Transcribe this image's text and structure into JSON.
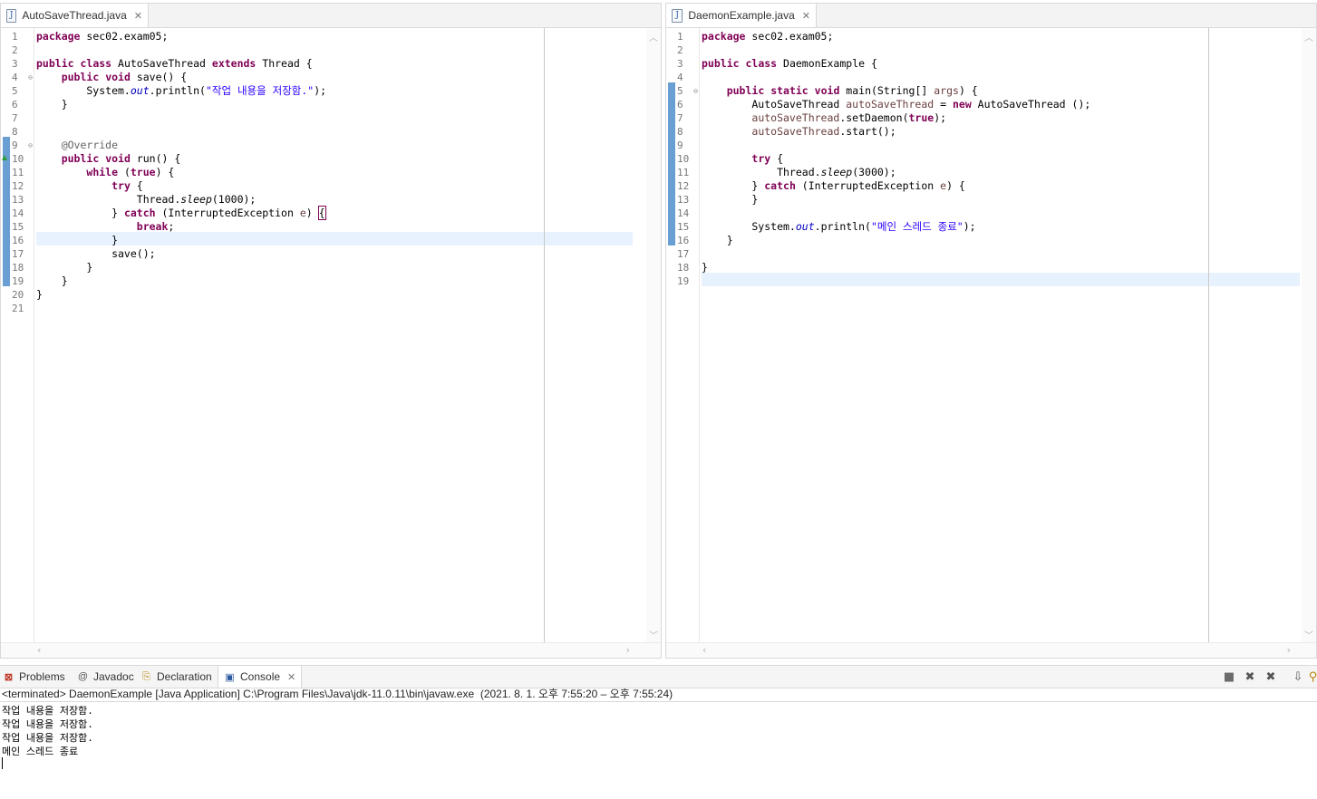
{
  "left_editor": {
    "tab_title": "AutoSaveThread.java",
    "tab_icon": "java-file-icon",
    "line_numbers": [
      "1",
      "2",
      "3",
      "4",
      "5",
      "6",
      "7",
      "8",
      "9",
      "10",
      "11",
      "12",
      "13",
      "14",
      "15",
      "16",
      "17",
      "18",
      "19",
      "20",
      "21"
    ],
    "code_lines": [
      [
        {
          "t": "package",
          "c": "kw"
        },
        {
          "t": " sec02.exam05;"
        }
      ],
      [],
      [
        {
          "t": "public",
          "c": "kw"
        },
        {
          "t": " "
        },
        {
          "t": "class",
          "c": "kw"
        },
        {
          "t": " AutoSaveThread "
        },
        {
          "t": "extends",
          "c": "kw"
        },
        {
          "t": " Thread {"
        }
      ],
      [
        {
          "t": "    "
        },
        {
          "t": "public",
          "c": "kw"
        },
        {
          "t": " "
        },
        {
          "t": "void",
          "c": "kw"
        },
        {
          "t": " save() {"
        }
      ],
      [
        {
          "t": "        System."
        },
        {
          "t": "out",
          "c": "fld"
        },
        {
          "t": ".println("
        },
        {
          "t": "\"작업 내용을 저장함.\"",
          "c": "str"
        },
        {
          "t": ");"
        }
      ],
      [
        {
          "t": "    }"
        }
      ],
      [],
      [],
      [
        {
          "t": "    "
        },
        {
          "t": "@Override",
          "c": "ann"
        }
      ],
      [
        {
          "t": "    "
        },
        {
          "t": "public",
          "c": "kw"
        },
        {
          "t": " "
        },
        {
          "t": "void",
          "c": "kw"
        },
        {
          "t": " run() {"
        }
      ],
      [
        {
          "t": "        "
        },
        {
          "t": "while",
          "c": "kw"
        },
        {
          "t": " ("
        },
        {
          "t": "true",
          "c": "kw"
        },
        {
          "t": ") {"
        }
      ],
      [
        {
          "t": "            "
        },
        {
          "t": "try",
          "c": "kw"
        },
        {
          "t": " {"
        }
      ],
      [
        {
          "t": "                Thread."
        },
        {
          "t": "sleep",
          "c": "ital"
        },
        {
          "t": "(1000);"
        }
      ],
      [
        {
          "t": "            } "
        },
        {
          "t": "catch",
          "c": "kw"
        },
        {
          "t": " (InterruptedException "
        },
        {
          "t": "e",
          "c": "var"
        },
        {
          "t": ") "
        },
        {
          "t": "{",
          "c": "bracket"
        }
      ],
      [
        {
          "t": "                "
        },
        {
          "t": "break",
          "c": "kw"
        },
        {
          "t": ";"
        }
      ],
      [
        {
          "t": "            }"
        }
      ],
      [
        {
          "t": "            save();"
        }
      ],
      [
        {
          "t": "        }"
        }
      ],
      [
        {
          "t": "    }"
        }
      ],
      [
        {
          "t": "}"
        }
      ],
      []
    ]
  },
  "right_editor": {
    "tab_title": "DaemonExample.java",
    "tab_icon": "java-file-icon",
    "line_numbers": [
      "1",
      "2",
      "3",
      "4",
      "5",
      "6",
      "7",
      "8",
      "9",
      "10",
      "11",
      "12",
      "13",
      "14",
      "15",
      "16",
      "17",
      "18",
      "19"
    ],
    "code_lines": [
      [
        {
          "t": "package",
          "c": "kw"
        },
        {
          "t": " sec02.exam05;"
        }
      ],
      [],
      [
        {
          "t": "public",
          "c": "kw"
        },
        {
          "t": " "
        },
        {
          "t": "class",
          "c": "kw"
        },
        {
          "t": " DaemonExample {"
        }
      ],
      [],
      [
        {
          "t": "    "
        },
        {
          "t": "public",
          "c": "kw"
        },
        {
          "t": " "
        },
        {
          "t": "static",
          "c": "kw"
        },
        {
          "t": " "
        },
        {
          "t": "void",
          "c": "kw"
        },
        {
          "t": " main(String[] "
        },
        {
          "t": "args",
          "c": "var"
        },
        {
          "t": ") {"
        }
      ],
      [
        {
          "t": "        AutoSaveThread "
        },
        {
          "t": "autoSaveThread",
          "c": "var"
        },
        {
          "t": " = "
        },
        {
          "t": "new",
          "c": "kw"
        },
        {
          "t": " AutoSaveThread ();"
        }
      ],
      [
        {
          "t": "        "
        },
        {
          "t": "autoSaveThread",
          "c": "var"
        },
        {
          "t": ".setDaemon("
        },
        {
          "t": "true",
          "c": "kw"
        },
        {
          "t": ");"
        }
      ],
      [
        {
          "t": "        "
        },
        {
          "t": "autoSaveThread",
          "c": "var"
        },
        {
          "t": ".start();"
        }
      ],
      [],
      [
        {
          "t": "        "
        },
        {
          "t": "try",
          "c": "kw"
        },
        {
          "t": " {"
        }
      ],
      [
        {
          "t": "            Thread."
        },
        {
          "t": "sleep",
          "c": "ital"
        },
        {
          "t": "(3000);"
        }
      ],
      [
        {
          "t": "        } "
        },
        {
          "t": "catch",
          "c": "kw"
        },
        {
          "t": " (InterruptedException "
        },
        {
          "t": "e",
          "c": "var"
        },
        {
          "t": ") {"
        }
      ],
      [
        {
          "t": "        }"
        }
      ],
      [],
      [
        {
          "t": "        System."
        },
        {
          "t": "out",
          "c": "fld"
        },
        {
          "t": ".println("
        },
        {
          "t": "\"메인 스레드 종료\"",
          "c": "str"
        },
        {
          "t": ");"
        }
      ],
      [
        {
          "t": "    }"
        }
      ],
      [],
      [
        {
          "t": "}"
        }
      ],
      []
    ]
  },
  "bottom_panel": {
    "tabs": [
      {
        "label": "Problems",
        "icon": "problems-icon"
      },
      {
        "label": "Javadoc",
        "icon": "at-sign-icon"
      },
      {
        "label": "Declaration",
        "icon": "declaration-icon"
      },
      {
        "label": "Console",
        "icon": "console-icon",
        "active": true
      }
    ],
    "console_header": "<terminated> DaemonExample [Java Application] C:\\Program Files\\Java\\jdk-11.0.11\\bin\\javaw.exe  (2021. 8. 1. 오후 7:55:20 – 오후 7:55:24)",
    "console_output": [
      "작업 내용을 저장함.",
      "작업 내용을 저장함.",
      "작업 내용을 저장함.",
      "메인 스레드 종료"
    ],
    "toolbar_icons": [
      "terminate-icon",
      "remove-launch-icon",
      "remove-all-launches-icon",
      "scroll-lock-icon",
      "pin-console-icon"
    ]
  },
  "colors": {
    "keyword": "#7f0055",
    "string": "#2a00ff",
    "annotation": "#646464",
    "static_field": "#0000c0",
    "local_variable": "#6a3e3e",
    "current_line": "#e8f2fe",
    "change_ruler": "#6a9fd4"
  }
}
